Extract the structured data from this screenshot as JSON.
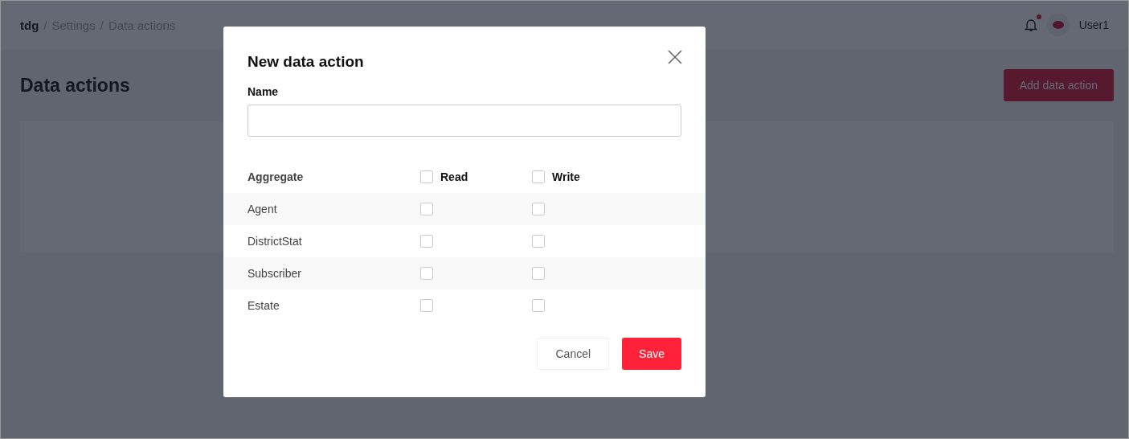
{
  "header": {
    "breadcrumb": [
      {
        "label": "tdg",
        "current": true
      },
      {
        "label": "Settings",
        "current": false
      },
      {
        "label": "Data actions",
        "current": false
      }
    ],
    "separator": "/",
    "notification_unread": true,
    "user": "User1"
  },
  "page": {
    "title": "Data actions",
    "add_button": "Add data action"
  },
  "modal": {
    "title": "New data action",
    "name_label": "Name",
    "columns": [
      {
        "label": "Aggregate",
        "kind": "text"
      },
      {
        "label": "Read",
        "kind": "check",
        "checked": false
      },
      {
        "label": "Write",
        "kind": "check",
        "checked": false
      }
    ],
    "rows": [
      {
        "name": "Agent",
        "read": false,
        "write": false
      },
      {
        "name": "DistrictStat",
        "read": false,
        "write": false
      },
      {
        "name": "Subscriber",
        "read": false,
        "write": false
      },
      {
        "name": "Estate",
        "read": false,
        "write": false
      }
    ],
    "cancel": "Cancel",
    "save": "Save"
  }
}
